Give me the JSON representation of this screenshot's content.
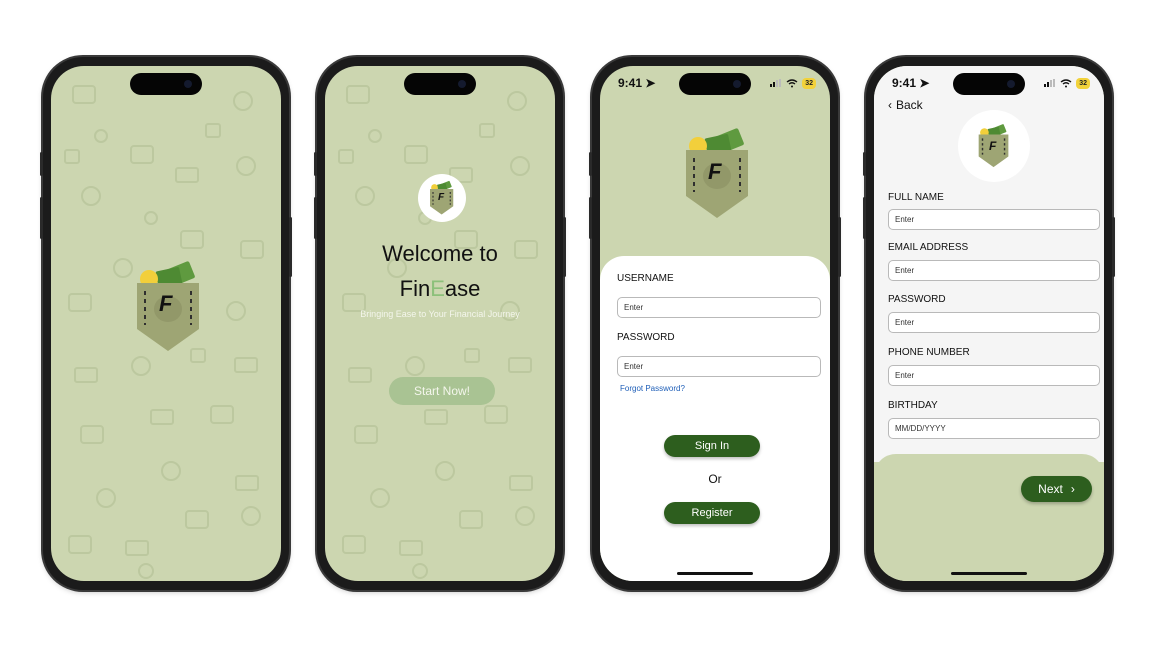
{
  "colors": {
    "sage_background": "#ccd6b0",
    "dark_green": "#2d5e1e",
    "light_green_button": "#a9c393",
    "pattern_icon": "#bcc89f",
    "link_blue": "#1f5fb8"
  },
  "status_bar": {
    "time": "9:41",
    "battery": "32"
  },
  "splash": {
    "logo_letter": "F"
  },
  "welcome": {
    "title_line1": "Welcome to",
    "title_fin": "Fin",
    "title_e": "E",
    "title_ase": "ase",
    "tagline": "Bringing Ease to Your Financial Journey",
    "start_button": "Start Now!",
    "logo_letter": "F"
  },
  "login": {
    "logo_letter": "F",
    "username_label": "USERNAME",
    "username_placeholder": "Enter",
    "password_label": "PASSWORD",
    "password_placeholder": "Enter",
    "forgot_link": "Forgot Password?",
    "sign_in_button": "Sign In",
    "or_text": "Or",
    "register_button": "Register"
  },
  "register": {
    "back_label": "Back",
    "logo_letter": "F",
    "fields": [
      {
        "label": "FULL NAME",
        "placeholder": "Enter"
      },
      {
        "label": "EMAIL ADDRESS",
        "placeholder": "Enter"
      },
      {
        "label": "PASSWORD",
        "placeholder": "Enter"
      },
      {
        "label": "PHONE NUMBER",
        "placeholder": "Enter"
      },
      {
        "label": "BIRTHDAY",
        "placeholder": "MM/DD/YYYY"
      }
    ],
    "next_button": "Next"
  }
}
